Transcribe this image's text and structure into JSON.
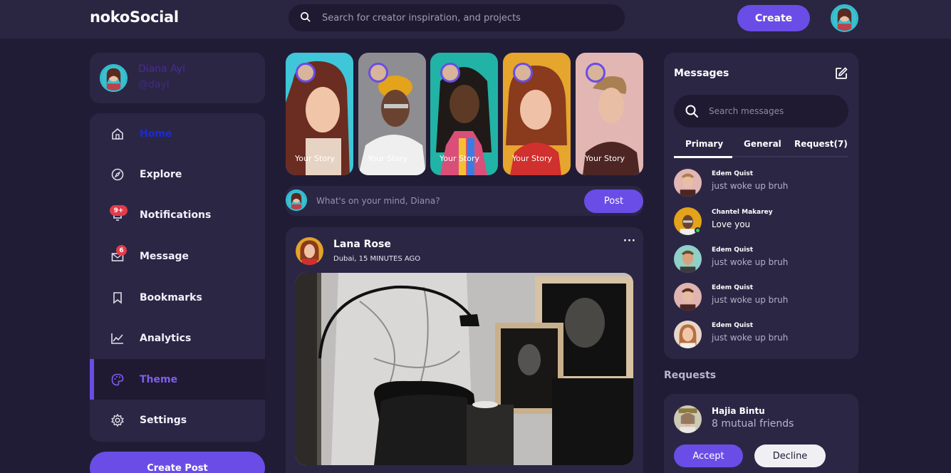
{
  "app": {
    "logo": "nokoSocial"
  },
  "header": {
    "search_placeholder": "Search for creator inspiration, and projects",
    "create_label": "Create"
  },
  "profile": {
    "name": "Diana Ayi",
    "handle": "@dayi"
  },
  "sidebar": {
    "items": [
      {
        "label": "Home",
        "icon": "home-icon"
      },
      {
        "label": "Explore",
        "icon": "compass-icon"
      },
      {
        "label": "Notifications",
        "icon": "bell-icon",
        "badge": "9+"
      },
      {
        "label": "Message",
        "icon": "envelope-icon",
        "badge": "6"
      },
      {
        "label": "Bookmarks",
        "icon": "bookmark-icon"
      },
      {
        "label": "Analytics",
        "icon": "chart-line-icon"
      },
      {
        "label": "Theme",
        "icon": "palette-icon",
        "active": true
      },
      {
        "label": "Settings",
        "icon": "gear-icon"
      }
    ],
    "create_post_label": "Create Post"
  },
  "stories": [
    {
      "label": "Your Story"
    },
    {
      "label": "Your Story"
    },
    {
      "label": "Your Story"
    },
    {
      "label": "Your Story"
    },
    {
      "label": "Your Story"
    }
  ],
  "composer": {
    "placeholder": "What's on your mind, Diana?",
    "post_label": "Post"
  },
  "feed": {
    "author": "Lana Rose",
    "meta": "Dubai, 15 MINUTES AGO",
    "more": "···"
  },
  "messages": {
    "title": "Messages",
    "search_placeholder": "Search messages",
    "tabs": [
      "Primary",
      "General",
      "Request(7)"
    ],
    "rows": [
      {
        "name": "Edem Quist",
        "text": "just woke up bruh"
      },
      {
        "name": "Chantel Makarey",
        "text": "Love you",
        "online": true
      },
      {
        "name": "Edem Quist",
        "text": "just woke up bruh"
      },
      {
        "name": "Edem Quist",
        "text": "just woke up bruh"
      },
      {
        "name": "Edem Quist",
        "text": "just woke up bruh"
      }
    ]
  },
  "requests": {
    "title": "Requests",
    "name": "Hajia Bintu",
    "subtitle": "8 mutual friends",
    "accept_label": "Accept",
    "decline_label": "Decline"
  },
  "colors": {
    "background": "#211c35",
    "card": "#2c2645",
    "accent": "#6a4de6",
    "badge": "#e23c4a"
  }
}
